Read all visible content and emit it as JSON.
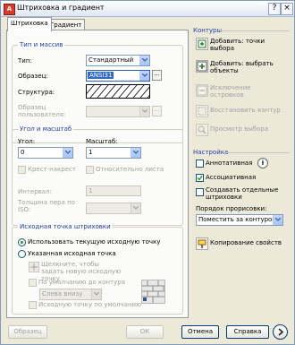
{
  "window": {
    "title": "Штриховка и градиент"
  },
  "tabs": [
    "Штриховка",
    "Градиент"
  ],
  "type_pattern": {
    "legend": "Тип и массив",
    "type_label": "Тип:",
    "type_value": "Стандартный",
    "pattern_label": "Образец:",
    "pattern_value": "ANSI31",
    "structure_label": "Структура:",
    "user_pattern_label": "Образец пользователя:"
  },
  "angle_scale": {
    "legend": "Угол и масштаб",
    "angle_label": "Угол:",
    "angle_value": "0",
    "scale_label": "Масштаб:",
    "scale_value": "1",
    "crosshatch_label": "Крест-накрест",
    "relative_label": "Относительно листа",
    "spacing_label": "Интервал:",
    "spacing_value": "1",
    "pen_width_label": "Толщина пера по ISO:"
  },
  "origin": {
    "legend": "Исходная точка штриховки",
    "use_current_label": "Использовать текущую исходную точку",
    "specified_label": "Указанная исходная точка",
    "click_label": "Щелкните, чтобы задать новую исходную точку",
    "default_boundary_label": "По умолчанию до контура",
    "position_value": "Слева внизу",
    "save_default_label": "Исходную точку по умолчанию"
  },
  "contours": {
    "heading": "Контуры",
    "add_points": "Добавить: точки выбора",
    "add_objects": "Добавить: выбрать объекты",
    "remove_islands": "Исключение островков",
    "recreate": "Восстановить контур",
    "view": "Просмотр выбора"
  },
  "settings": {
    "heading": "Настройка",
    "annotative": "Аннотативная",
    "associative": "Ассоциативная",
    "separate": "Создавать отдельные штриховки",
    "draw_order_label": "Порядок прорисовки:",
    "draw_order_value": "Поместить за контуром",
    "inherit": "Копирование свойств"
  },
  "footer": {
    "preview": "Образец",
    "ok": "ОК",
    "cancel": "Отмена",
    "help": "Справка"
  }
}
